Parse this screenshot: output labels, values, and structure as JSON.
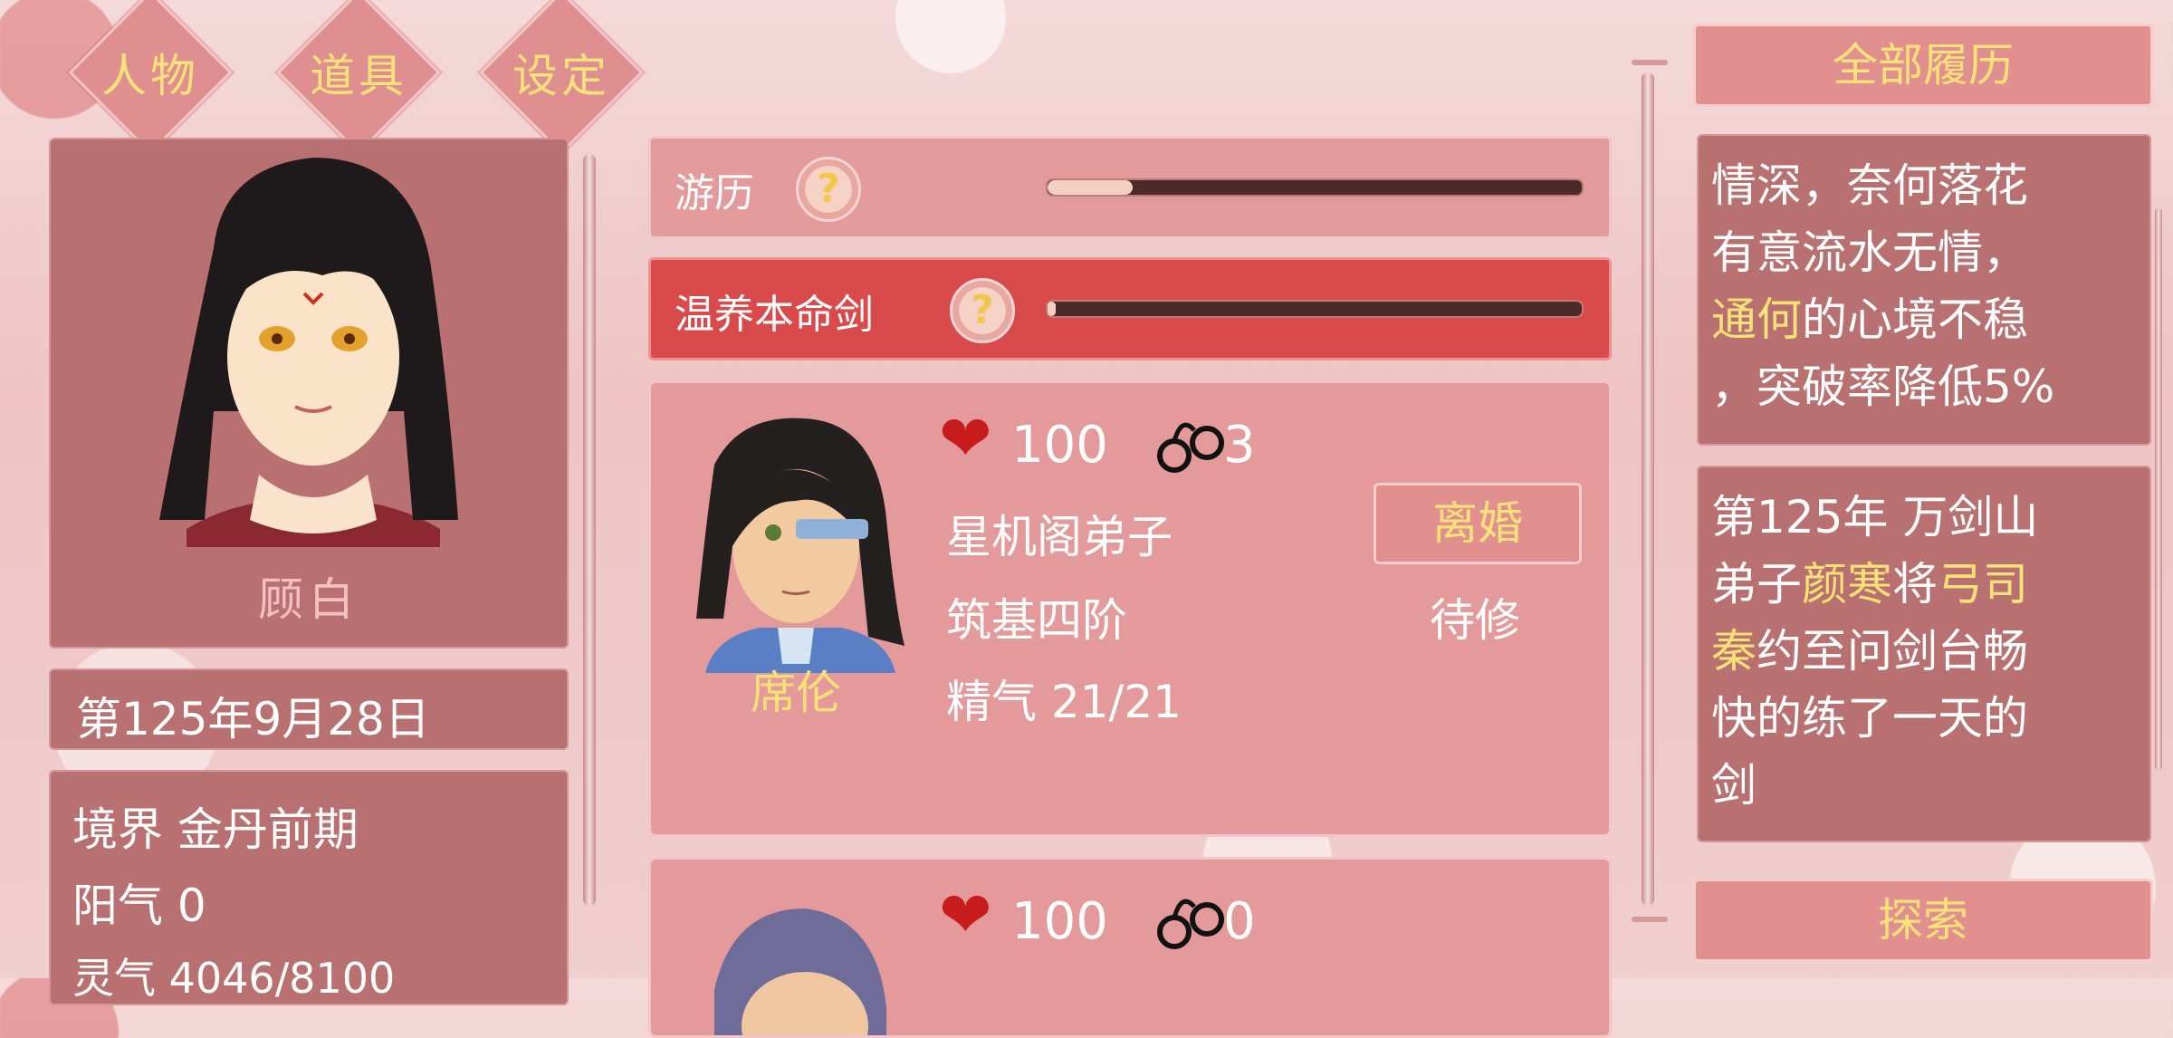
{
  "tabs": {
    "character": "人物",
    "items": "道具",
    "settings": "设定"
  },
  "player": {
    "name": "顾白",
    "date": "第125年9月28日",
    "realm": "境界 金丹前期",
    "yang": "阳气 0",
    "spirit_partial": "灵气 4046/8100"
  },
  "activities": {
    "travel": {
      "label": "游历",
      "progress": 0.16
    },
    "sword": {
      "label": "温养本命剑",
      "progress": 0.01
    }
  },
  "partners": [
    {
      "name": "席伦",
      "affection": "100",
      "bond": "3",
      "sect": "星机阁弟子",
      "stage": "筑基四阶",
      "essence": "精气 21/21",
      "action": "离婚",
      "state": "待修"
    },
    {
      "affection": "100",
      "bond": "0"
    }
  ],
  "history": {
    "button": "全部履历",
    "entry1": [
      {
        "t": "情深，奈何落花",
        "c": "white"
      },
      {
        "t": "有意流水无情，",
        "c": "white"
      },
      {
        "t": "通何",
        "c": "gold",
        "rest": "的心境不稳"
      },
      {
        "t": "，突破率降低5%",
        "c": "white"
      }
    ],
    "entry2": {
      "l1": "第125年 万剑山",
      "l2a": "弟子",
      "l2b": "颜寒",
      "l2c": "将",
      "l2d": "弓司",
      "l3a": "秦",
      "l3b": "约至问剑台畅",
      "l4": "快的练了一天的",
      "l5": "剑"
    }
  },
  "explore": "探索",
  "colors": {
    "accent_gold": "#f7e277",
    "heart_red": "#c81c1c",
    "panel": "#b97070",
    "active_row": "#d94a4a"
  }
}
